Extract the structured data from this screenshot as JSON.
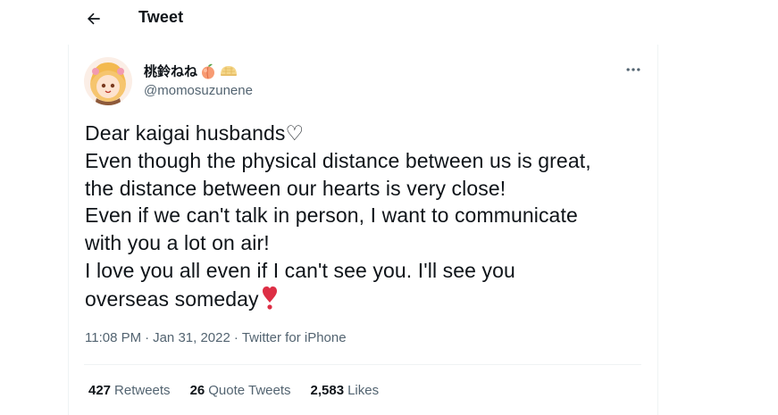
{
  "header": {
    "title": "Tweet"
  },
  "tweet": {
    "display_name": "桃鈴ねね",
    "name_emojis": [
      "peach-emoji",
      "melon-bread-emoji"
    ],
    "handle": "@momosuzunene",
    "text": "Dear kaigai husbands♡\nEven though the physical distance between us is great,\nthe distance between our hearts is very close!\nEven if we can't talk in person, I want to communicate\nwith you a lot on air!\nI love you all even if I can't see you. I'll see you\noverseas someday",
    "text_end_emoji": "heavy-exclamation-heart-emoji",
    "time": "11:08 PM",
    "date": "Jan 31, 2022",
    "source": "Twitter for iPhone",
    "separator": "·"
  },
  "stats": {
    "retweets_count": "427",
    "retweets_label": "Retweets",
    "quotes_count": "26",
    "quotes_label": "Quote Tweets",
    "likes_count": "2,583",
    "likes_label": "Likes"
  },
  "colors": {
    "text_primary": "#0f1419",
    "text_secondary": "#536471",
    "divider": "#eff3f4",
    "heart_red": "#dd2e44"
  }
}
